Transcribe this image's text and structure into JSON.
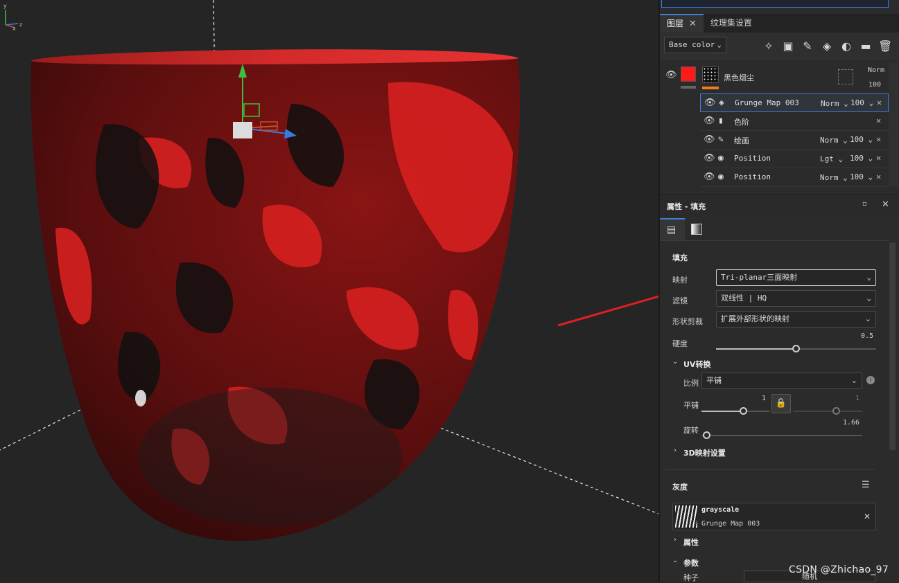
{
  "viewport": {
    "colors": {
      "background": "#252525",
      "material": "#c81e1e",
      "dark": "#1a1a1a"
    }
  },
  "axis_small": {
    "x": "x",
    "y": "y",
    "z": "z"
  },
  "tabs": [
    {
      "label": "图层",
      "active": true
    },
    {
      "label": "纹理集设置",
      "active": false
    }
  ],
  "toolbar": {
    "channel_select": "Base color",
    "icons": [
      "magic-wand-icon",
      "mask-icon",
      "brush-icon",
      "fill-icon",
      "smart-material-icon",
      "folder-icon",
      "trash-icon"
    ]
  },
  "layer": {
    "name": "黑色烟尘",
    "blend": "Norm",
    "opacity": "100",
    "color": "#ff1a1a"
  },
  "effects": [
    {
      "name": "Grunge Map 003",
      "blend": "Norm",
      "opacity": "100",
      "icon": "fill-icon",
      "selected": true
    },
    {
      "name": "色阶",
      "blend": "",
      "opacity": "",
      "icon": "levels-icon",
      "selected": false
    },
    {
      "name": "绘画",
      "blend": "Norm",
      "opacity": "100",
      "icon": "brush-icon",
      "selected": false
    },
    {
      "name": "Position",
      "blend": "Lgt",
      "opacity": "100",
      "icon": "generator-icon",
      "selected": false
    },
    {
      "name": "Position",
      "blend": "Norm",
      "opacity": "100",
      "icon": "generator-icon",
      "selected": false
    }
  ],
  "properties": {
    "title": "属性 - 填充",
    "fill_section": "填充",
    "mapping_label": "映射",
    "mapping_value": "Tri-planar三面映射",
    "filter_label": "滤镜",
    "filter_value": "双线性 | HQ",
    "clip_label": "形状剪裁",
    "clip_value": "扩展外部形状的映射",
    "hardness_label": "硬度",
    "hardness_value": "0.5",
    "uv_section": "UV转换",
    "scale_label": "比例",
    "scale_value": "平铺",
    "tile_label": "平铺",
    "tile_value": "1",
    "tile_value2": "1",
    "rotation_label": "旋转",
    "rotation_value": "1.66",
    "map3d_section": "3D映射设置",
    "gray_section": "灰度",
    "gray_card_title": "grayscale",
    "gray_card_sub": "Grunge Map 003",
    "attr_section": "属性",
    "params_section": "参数",
    "seed_label": "种子",
    "seed_button": "随机"
  },
  "watermark": "CSDN @Zhichao_97"
}
